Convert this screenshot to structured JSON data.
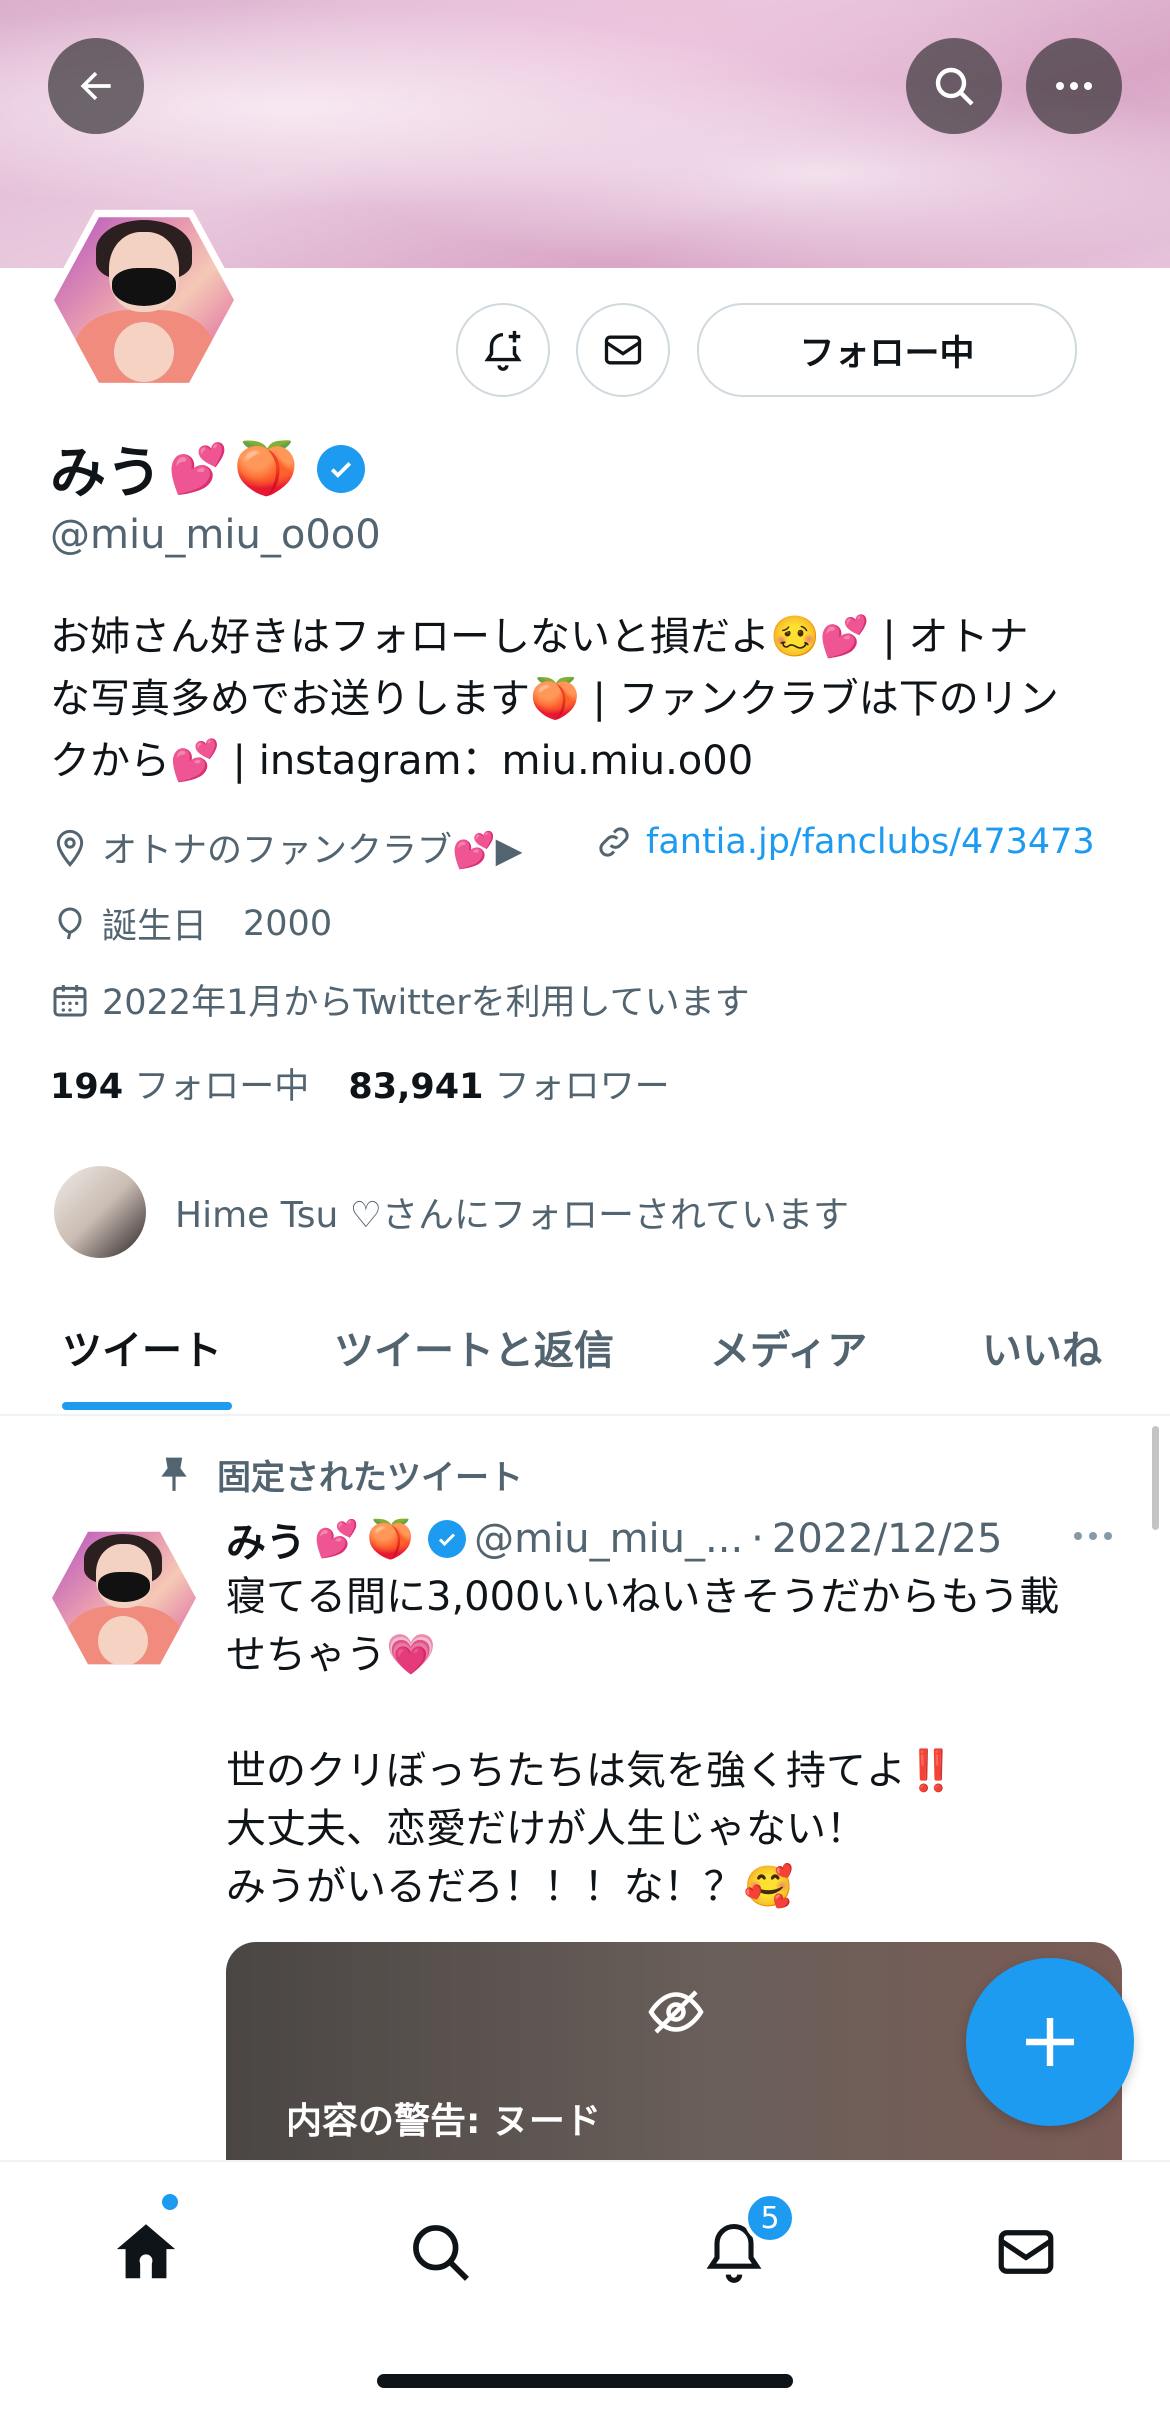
{
  "header": {
    "back_icon": "arrow-left-icon",
    "search_icon": "search-icon",
    "more_icon": "more-horizontal-icon"
  },
  "profile_actions": {
    "notify_icon": "bell-plus-icon",
    "message_icon": "envelope-icon",
    "follow_label": "フォロー中"
  },
  "profile": {
    "name": "みう",
    "name_emoji_1": "💕",
    "name_emoji_2": "🍑",
    "verified": true,
    "handle": "@miu_miu_o0o0",
    "bio_line_1": "お姉さん好きはフォローしないと損だよ🥴💕 | オトナ",
    "bio_line_2": "な写真多めでお送りします🍑 | ファンクラブは下のリン",
    "bio_line_3": "クから💕 | instagram：miu.miu.o00",
    "location": "オトナのファンクラブ💕▶︎",
    "url": "fantia.jp/fanclubs/473473",
    "birthday_label": "誕生日",
    "birthday_value": "2000",
    "joined": "2022年1月からTwitterを利用しています",
    "following_count": "194",
    "following_label": "フォロー中",
    "followers_count": "83,941",
    "followers_label": "フォロワー"
  },
  "followed_by": {
    "text": "Hime Tsu ♡さんにフォローされています"
  },
  "tabs": [
    {
      "label": "ツイート",
      "active": true
    },
    {
      "label": "ツイートと返信",
      "active": false
    },
    {
      "label": "メディア",
      "active": false
    },
    {
      "label": "いいね",
      "active": false
    }
  ],
  "pinned_tweet": {
    "pinned_label": "固定されたツイート",
    "author_name": "みう",
    "author_emoji_1": "💕",
    "author_emoji_2": "🍑",
    "author_handle": "@miu_miu_...",
    "dot": "·",
    "date": "2022/12/25",
    "body_line_1": "寝てる間に3,000いいねいきそうだからもう載",
    "body_line_2": "せちゃう💗",
    "body_line_3": "世のクリぼっちたちは気を強く持てよ‼️",
    "body_line_4": "大丈夫、恋愛だけが人生じゃない！",
    "body_line_5": "みうがいるだろ！！！な！？🥰",
    "media_warning": "内容の警告: ヌード"
  },
  "bottom_nav": {
    "home_icon": "home-icon",
    "search_icon": "search-icon",
    "notifications_icon": "bell-icon",
    "messages_icon": "envelope-icon",
    "notification_count": "5"
  },
  "colors": {
    "accent": "#1d9bf0",
    "text_primary": "#0f1419",
    "text_secondary": "#536471"
  }
}
